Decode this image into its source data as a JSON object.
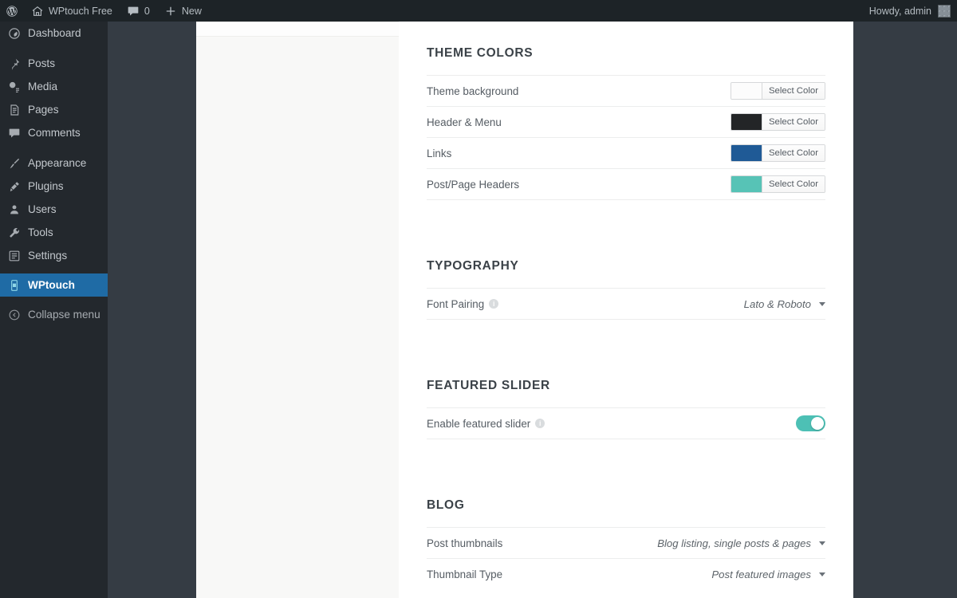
{
  "adminbar": {
    "logo_icon": "wordpress-logo-icon",
    "site_icon": "home-icon",
    "site_name": "WPtouch Free",
    "comments_icon": "comment-bubble-icon",
    "comments_count": "0",
    "new_icon": "plus-icon",
    "new_label": "New",
    "howdy": "Howdy, admin",
    "avatar_name": "user-avatar"
  },
  "sidebar": {
    "items": [
      {
        "label": "Dashboard",
        "icon": "dashboard-icon",
        "active": false
      },
      {
        "label": "Posts",
        "icon": "pin-icon",
        "active": false
      },
      {
        "label": "Media",
        "icon": "media-icon",
        "active": false
      },
      {
        "label": "Pages",
        "icon": "page-icon",
        "active": false
      },
      {
        "label": "Comments",
        "icon": "comment-bubble-icon",
        "active": false
      },
      {
        "label": "Appearance",
        "icon": "paintbrush-icon",
        "active": false
      },
      {
        "label": "Plugins",
        "icon": "plug-icon",
        "active": false
      },
      {
        "label": "Users",
        "icon": "users-icon",
        "active": false
      },
      {
        "label": "Tools",
        "icon": "wrench-icon",
        "active": false
      },
      {
        "label": "Settings",
        "icon": "settings-sliders-icon",
        "active": false
      },
      {
        "label": "WPtouch",
        "icon": "wptouch-icon",
        "active": true
      }
    ],
    "collapse_label": "Collapse menu",
    "collapse_icon": "collapse-arrow-icon",
    "active_color": "#1f6ba5",
    "background_color": "#23282d"
  },
  "sections": [
    {
      "title": "THEME COLORS",
      "rows": [
        {
          "type": "color",
          "label": "Theme background",
          "swatch": "#fcfcfc",
          "button": "Select Color"
        },
        {
          "type": "color",
          "label": "Header & Menu",
          "swatch": "#232527",
          "button": "Select Color"
        },
        {
          "type": "color",
          "label": "Links",
          "swatch": "#1f5a96",
          "button": "Select Color"
        },
        {
          "type": "color",
          "label": "Post/Page Headers",
          "swatch": "#57c3b6",
          "button": "Select Color"
        }
      ]
    },
    {
      "title": "TYPOGRAPHY",
      "rows": [
        {
          "type": "select",
          "label": "Font Pairing",
          "help": true,
          "value": "Lato & Roboto"
        }
      ]
    },
    {
      "title": "FEATURED SLIDER",
      "rows": [
        {
          "type": "toggle",
          "label": "Enable featured slider",
          "help": true,
          "on": true
        }
      ]
    },
    {
      "title": "BLOG",
      "rows": [
        {
          "type": "select",
          "label": "Post thumbnails",
          "help": false,
          "value": "Blog listing, single posts & pages"
        },
        {
          "type": "select",
          "label": "Thumbnail Type",
          "help": false,
          "value": "Post featured images"
        }
      ]
    }
  ],
  "colors": {
    "toggle_on": "#4dc0b5",
    "accent_teal": "#57c3b6",
    "admin_bar": "#1d2327",
    "page_frame": "#353c44"
  }
}
